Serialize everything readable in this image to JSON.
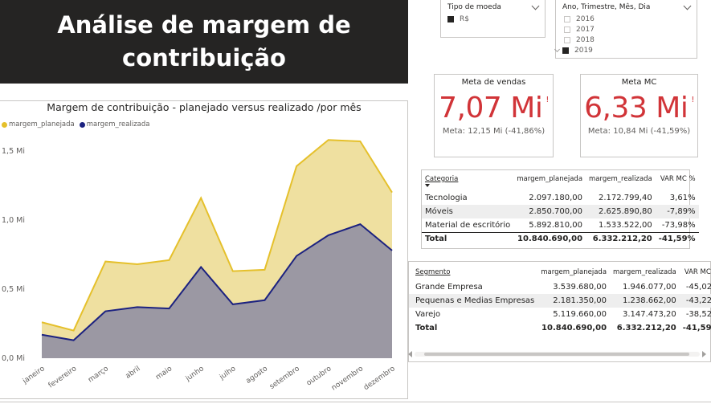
{
  "banner": {
    "title": "Análise de margem de contribuição"
  },
  "slicer_currency": {
    "title": "Tipo de moeda",
    "options": [
      {
        "label": "R$",
        "checked": true
      }
    ]
  },
  "slicer_date": {
    "title": "Ano, Trimestre, Mês, Dia",
    "options": [
      {
        "label": "2016",
        "checked": false
      },
      {
        "label": "2017",
        "checked": false
      },
      {
        "label": "2018",
        "checked": false
      },
      {
        "label": "2019",
        "checked": true
      }
    ]
  },
  "card_sales": {
    "title": "Meta de vendas",
    "value": "7,07 Mi",
    "flag": "!",
    "goal": "Meta: 12,15 Mi (-41,86%)"
  },
  "card_mc": {
    "title": "Meta MC",
    "value": "6,33 Mi",
    "flag": "!",
    "goal": "Meta: 10,84 Mi (-41,59%)"
  },
  "table_category": {
    "headers": [
      "Categoria",
      "margem_planejada",
      "margem_realizada",
      "VAR MC %"
    ],
    "rows": [
      [
        "Tecnologia",
        "2.097.180,00",
        "2.172.799,40",
        "3,61%"
      ],
      [
        "Móveis",
        "2.850.700,00",
        "2.625.890,80",
        "-7,89%"
      ],
      [
        "Material de escritório",
        "5.892.810,00",
        "1.533.522,00",
        "-73,98%"
      ]
    ],
    "total": [
      "Total",
      "10.840.690,00",
      "6.332.212,20",
      "-41,59%"
    ]
  },
  "table_segment": {
    "headers": [
      "Segmento",
      "margem_planejada",
      "margem_realizada",
      "VAR MC %"
    ],
    "rows": [
      [
        "Grande Empresa",
        "3.539.680,00",
        "1.946.077,00",
        "-45,02%"
      ],
      [
        "Pequenas e Medias Empresas",
        "2.181.350,00",
        "1.238.662,00",
        "-43,22%"
      ],
      [
        "Varejo",
        "5.119.660,00",
        "3.147.473,20",
        "-38,52%"
      ]
    ],
    "total": [
      "Total",
      "10.840.690,00",
      "6.332.212,20",
      "-41,59%"
    ]
  },
  "chart_data": {
    "type": "area",
    "title": "Margem de contribuição - planejado versus realizado /por mês",
    "categories": [
      "janeiro",
      "fevereiro",
      "março",
      "abril",
      "maio",
      "junho",
      "julho",
      "agosto",
      "setembro",
      "outubro",
      "novembro",
      "dezembro"
    ],
    "series": [
      {
        "name": "margem_planejada",
        "color": "#e5c02b",
        "fill": "#efe0a0",
        "values": [
          0.26,
          0.2,
          0.7,
          0.68,
          0.71,
          1.16,
          0.63,
          0.64,
          1.39,
          1.58,
          1.57,
          1.2
        ]
      },
      {
        "name": "margem_realizada",
        "color": "#1c2280",
        "fill": "#9b98a3",
        "values": [
          0.17,
          0.13,
          0.34,
          0.37,
          0.36,
          0.66,
          0.39,
          0.42,
          0.74,
          0.89,
          0.97,
          0.78
        ]
      }
    ],
    "y_ticks": [
      "0,0 Mi",
      "0,5 Mi",
      "1,0 Mi",
      "1,5 Mi"
    ],
    "ylim": [
      0,
      1.5
    ],
    "legend_position": "top-left",
    "grid": false
  }
}
